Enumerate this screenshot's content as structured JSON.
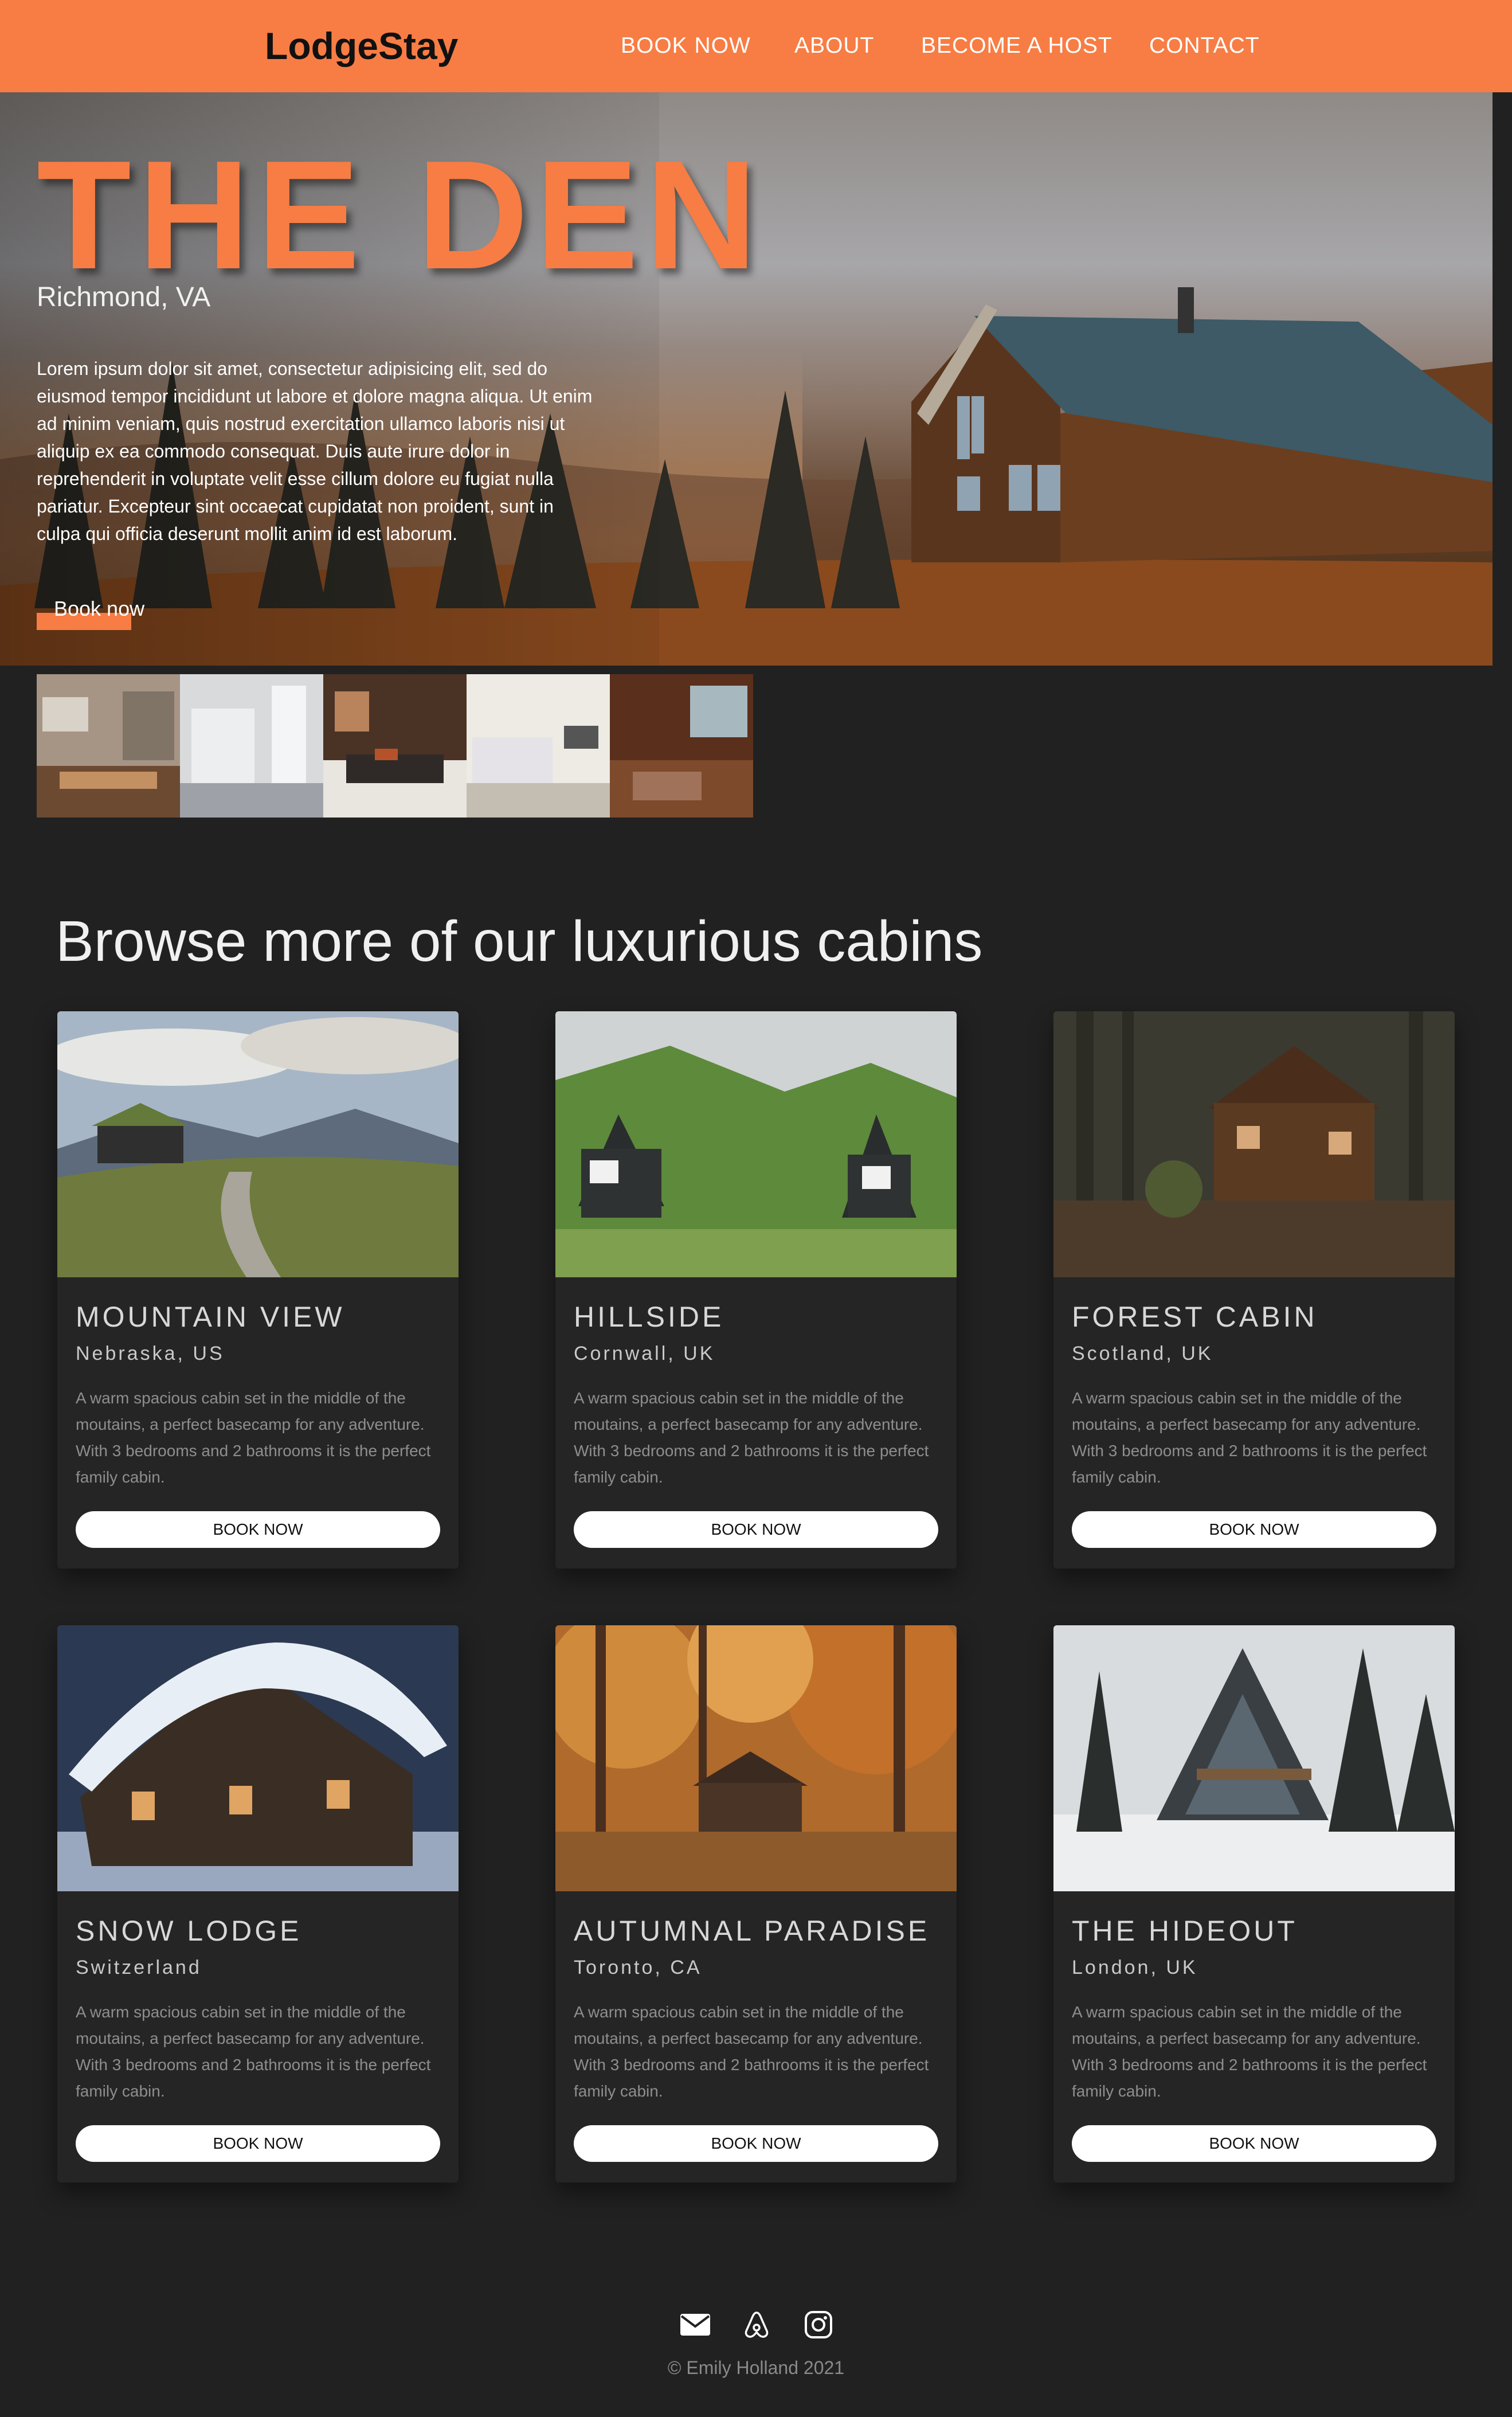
{
  "nav": {
    "brand": "LodgeStay",
    "links": [
      "BOOK NOW",
      "ABOUT",
      "BECOME A HOST",
      "CONTACT"
    ]
  },
  "hero": {
    "title": "THE DEN",
    "location": "Richmond, VA",
    "description": "Lorem ipsum dolor sit amet, consectetur adipisicing elit, sed do eiusmod tempor incididunt ut labore et dolore magna aliqua. Ut enim ad minim veniam, quis nostrud exercitation ullamco laboris nisi ut aliquip ex ea commodo consequat. Duis aute irure dolor in reprehenderit in voluptate velit esse cillum dolore eu fugiat nulla pariatur. Excepteur sint occaecat cupidatat non proident, sunt in culpa qui officia deserunt mollit anim id est laborum.",
    "button": "Book now"
  },
  "gallery": [
    "kitchen",
    "white-kitchen",
    "bedroom-dark",
    "bedroom-light",
    "living-room"
  ],
  "browse": {
    "title": "Browse more of our luxurious cabins",
    "cards": [
      {
        "name": "MOUNTAIN VIEW",
        "location": "Nebraska, US",
        "description": "A warm spacious cabin set in the middle of the moutains, a perfect basecamp for any adventure. With 3 bedrooms and 2 bathrooms it is the perfect family cabin.",
        "button": "BOOK NOW"
      },
      {
        "name": "HILLSIDE",
        "location": "Cornwall, UK",
        "description": "A warm spacious cabin set in the middle of the moutains, a perfect basecamp for any adventure. With 3 bedrooms and 2 bathrooms it is the perfect family cabin.",
        "button": "BOOK NOW"
      },
      {
        "name": "FOREST CABIN",
        "location": "Scotland, UK",
        "description": "A warm spacious cabin set in the middle of the moutains, a perfect basecamp for any adventure. With 3 bedrooms and 2 bathrooms it is the perfect family cabin.",
        "button": "BOOK NOW"
      },
      {
        "name": "SNOW LODGE",
        "location": "Switzerland",
        "description": "A warm spacious cabin set in the middle of the moutains, a perfect basecamp for any adventure. With 3 bedrooms and 2 bathrooms it is the perfect family cabin.",
        "button": "BOOK NOW"
      },
      {
        "name": "AUTUMNAL PARADISE",
        "location": "Toronto, CA",
        "description": "A warm spacious cabin set in the middle of the moutains, a perfect basecamp for any adventure. With 3 bedrooms and 2 bathrooms it is the perfect family cabin.",
        "button": "BOOK NOW"
      },
      {
        "name": "THE HIDEOUT",
        "location": "London, UK",
        "description": "A warm spacious cabin set in the middle of the moutains, a perfect basecamp for any adventure. With 3 bedrooms and 2 bathrooms it is the perfect family cabin.",
        "button": "BOOK NOW"
      }
    ]
  },
  "footer": {
    "icons": [
      "email-icon",
      "airbnb-icon",
      "instagram-icon"
    ],
    "copyright": "© Emily Holland 2021"
  },
  "colors": {
    "accent": "#f77d44",
    "background": "#212121",
    "card": "#252525"
  }
}
